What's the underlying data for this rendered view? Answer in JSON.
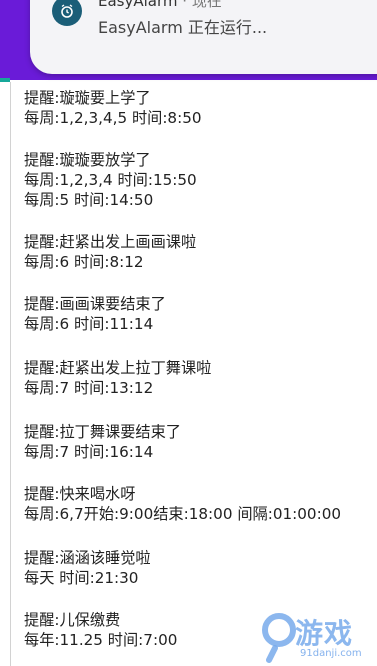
{
  "notification": {
    "app_name": "EasyAlarm",
    "separator": "·",
    "time": "现在",
    "body": "EasyAlarm 正在运行...",
    "icon": "alarm-clock-icon"
  },
  "alarms": [
    {
      "reminder": "提醒:璇璇要上学了",
      "schedule": [
        "每周:1,2,3,4,5 时间:8:50"
      ]
    },
    {
      "reminder": "提醒:璇璇要放学了",
      "schedule": [
        "每周:1,2,3,4 时间:15:50",
        "每周:5 时间:14:50"
      ]
    },
    {
      "reminder": "提醒:赶紧出发上画画课啦",
      "schedule": [
        "每周:6 时间:8:12"
      ]
    },
    {
      "reminder": "提醒:画画课要结束了",
      "schedule": [
        "每周:6 时间:11:14"
      ]
    },
    {
      "reminder": "提醒:赶紧出发上拉丁舞课啦",
      "schedule": [
        "每周:7 时间:13:12"
      ]
    },
    {
      "reminder": "提醒:拉丁舞课要结束了",
      "schedule": [
        "每周:7 时间:16:14"
      ]
    },
    {
      "reminder": "提醒:快来喝水呀",
      "schedule": [
        "每周:6,7开始:9:00结束:18:00 间隔:01:00:00"
      ]
    },
    {
      "reminder": "提醒:涵涵该睡觉啦",
      "schedule": [
        "每天 时间:21:30"
      ]
    },
    {
      "reminder": "提醒:儿保缴费",
      "schedule": [
        "每年:11.25 时间:7:00"
      ]
    }
  ],
  "watermark": {
    "text": "游戏",
    "sub": "91danji.com"
  },
  "colors": {
    "band": "#6a1bd8",
    "notification_bg": "#f4f4f7",
    "icon_bg": "#1b5e78",
    "accent_teal": "#16a89a"
  }
}
